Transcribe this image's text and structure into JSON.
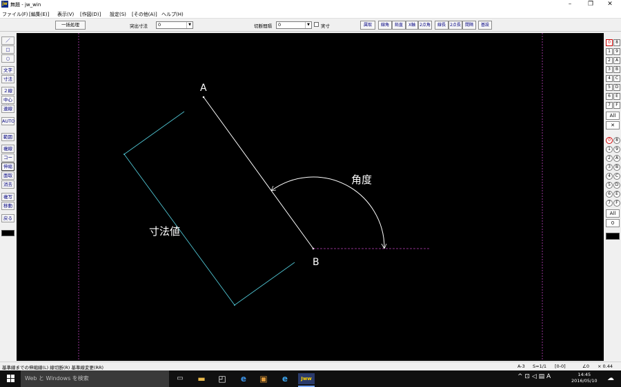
{
  "window": {
    "icon": "jw",
    "title": "無題 - jw_win",
    "minimize": "–",
    "maximize": "❐",
    "close": "✕"
  },
  "menu": [
    "ファイル(F)",
    "[編集(E)]",
    "表示(V)",
    "[作図(D)]",
    "設定(S)",
    "[その他(A)]",
    "ヘルプ(H)"
  ],
  "toolbar": {
    "batch_button": "一括処理",
    "protrusion_label": "突出寸法",
    "protrusion_value": "0",
    "gap_label": "切断間隔",
    "gap_value": "0",
    "actual_label": "実寸",
    "right_buttons": [
      "属取",
      "線角",
      "鉛直",
      "X軸",
      "2点角",
      "線長",
      "2点長",
      "間隔",
      "基設"
    ]
  },
  "left_tools": [
    "／",
    "□",
    "○",
    "文字",
    "寸法",
    "２線",
    "中心線",
    "連線",
    "AUTO",
    "範囲",
    "複線",
    "コーナー",
    "伸縮",
    "面取",
    "消去",
    "複写",
    "移動",
    "戻る"
  ],
  "layers": {
    "group_buttons": [
      "0",
      "8",
      "1",
      "9",
      "2",
      "A",
      "3",
      "B",
      "4",
      "C",
      "5",
      "D",
      "6",
      "E",
      "7",
      "F"
    ],
    "layer_buttons": [
      "0",
      "8",
      "1",
      "9",
      "2",
      "A",
      "3",
      "B",
      "4",
      "C",
      "5",
      "D",
      "6",
      "E",
      "7",
      "F"
    ],
    "all_label": "All",
    "cross_label": "✕",
    "all2_label": "All",
    "zero_label": "0"
  },
  "drawing": {
    "label_a": "A",
    "label_b": "B",
    "label_angle": "角度",
    "label_dim": "寸法値"
  },
  "status": {
    "message": "基準線までの伸縮線(L) 線切断(R) 基準線変更(RR)",
    "paper": "A-3",
    "scale": "S=1/1",
    "layer": "[0-0]",
    "angle": "∠0",
    "zoom": "× 0.44"
  },
  "taskbar": {
    "search_placeholder": "Web と Windows を検索",
    "ime": "A",
    "time": "14:45",
    "date": "2016/05/10"
  },
  "colors": {
    "canvas_bg": "#000000",
    "line_white": "#ffffff",
    "line_cyan": "#4fc4d2",
    "guide_magenta": "#c040c0"
  }
}
